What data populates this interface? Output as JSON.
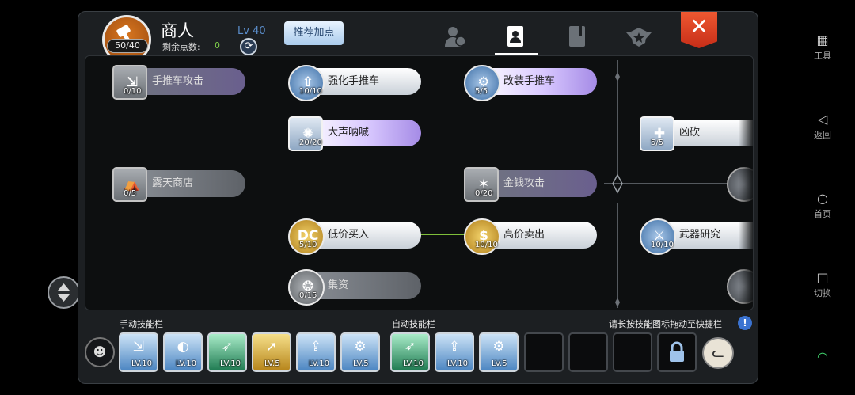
{
  "header": {
    "class_name": "商人",
    "skill_points_label": "剩余点数:",
    "skill_points_value": "0",
    "sp_badge": "50/40",
    "level": "Lv 40",
    "recommend_label": "推荐加点",
    "tabs": [
      "profile-icon",
      "skill-book-icon",
      "book-icon",
      "emblem-icon"
    ],
    "active_tab": 1,
    "close_label": "✕"
  },
  "tree": {
    "nodes": [
      {
        "name": "手推车攻击",
        "level": "0/10",
        "state": "locked-purple"
      },
      {
        "name": "强化手推车",
        "level": "10/10",
        "state": "unlocked"
      },
      {
        "name": "改装手推车",
        "level": "5/5",
        "state": "unlocked-purple"
      },
      {
        "name": "大声呐喊",
        "level": "20/20",
        "state": "unlocked-purple"
      },
      {
        "name": "凶砍",
        "level": "5/5",
        "state": "unlocked"
      },
      {
        "name": "露天商店",
        "level": "0/5",
        "state": "locked"
      },
      {
        "name": "金钱攻击",
        "level": "0/20",
        "state": "locked-purple"
      },
      {
        "name": "低价买入",
        "level": "5/10",
        "state": "unlocked"
      },
      {
        "name": "高价卖出",
        "level": "10/10",
        "state": "unlocked"
      },
      {
        "name": "武器研究",
        "level": "10/10",
        "state": "unlocked"
      },
      {
        "name": "集资",
        "level": "0/15",
        "state": "locked"
      }
    ],
    "colors": {
      "unlocked": "#ffffff",
      "purple": "#a58be6",
      "locked": "#6b7075",
      "connector": "#7fbf3a"
    }
  },
  "bars": {
    "manual_label": "手动技能栏",
    "auto_label": "自动技能栏",
    "hint": "请长按技能图标拖动至快捷栏",
    "manual_slots": [
      "LV.10",
      "LV.10",
      "LV.10",
      "LV.5",
      "LV.10",
      "LV.5"
    ],
    "auto_slots": [
      "LV.10",
      "LV.10",
      "LV.5"
    ]
  },
  "android_nav": {
    "tools": "工具",
    "back": "返回",
    "home": "首页",
    "switch": "切换"
  }
}
